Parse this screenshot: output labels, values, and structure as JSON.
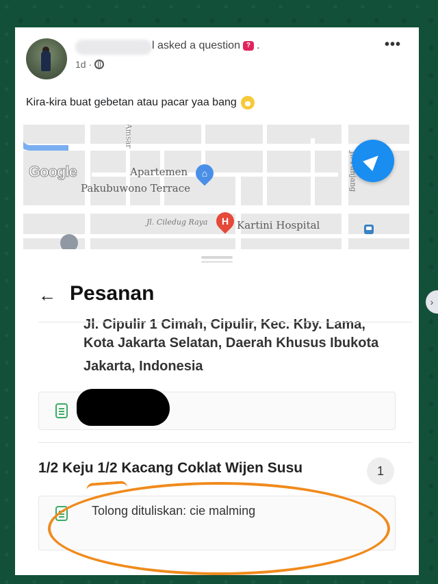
{
  "post": {
    "asked_text": "l asked a question",
    "time": "1d",
    "dot": "·",
    "more": "•••",
    "text": "Kira-kira buat gebetan atau pacar yaa bang"
  },
  "map": {
    "logo": "Google",
    "place1_line1": "Apartemen",
    "place1_line2": "Pakubuwono Terrace",
    "street1": "Jl. Ciledug Raya",
    "hospital_marker": "H",
    "hospital": "Kartini Hospital",
    "street2": "Jl. Panjang",
    "street3": "Amsar"
  },
  "order": {
    "title": "Pesanan",
    "address_partial": "Jl. Cipulir 1 Cimah, Cipulir, Kec. Kby. Lama,",
    "address_line1": "Kota Jakarta Selatan, Daerah Khusus Ibukota",
    "address_line2": "Jakarta, Indonesia",
    "item_name": "1/2 Keju 1/2 Kacang Coklat Wijen Susu",
    "item_qty": "1",
    "item_note": "Tolong dituliskan: cie malming"
  },
  "colors": {
    "background": "#12503a",
    "nav_button": "#1a8df0",
    "note_icon": "#3caa64",
    "annotation_circle": "#f08a1c",
    "question_badge": "#e0245e"
  }
}
